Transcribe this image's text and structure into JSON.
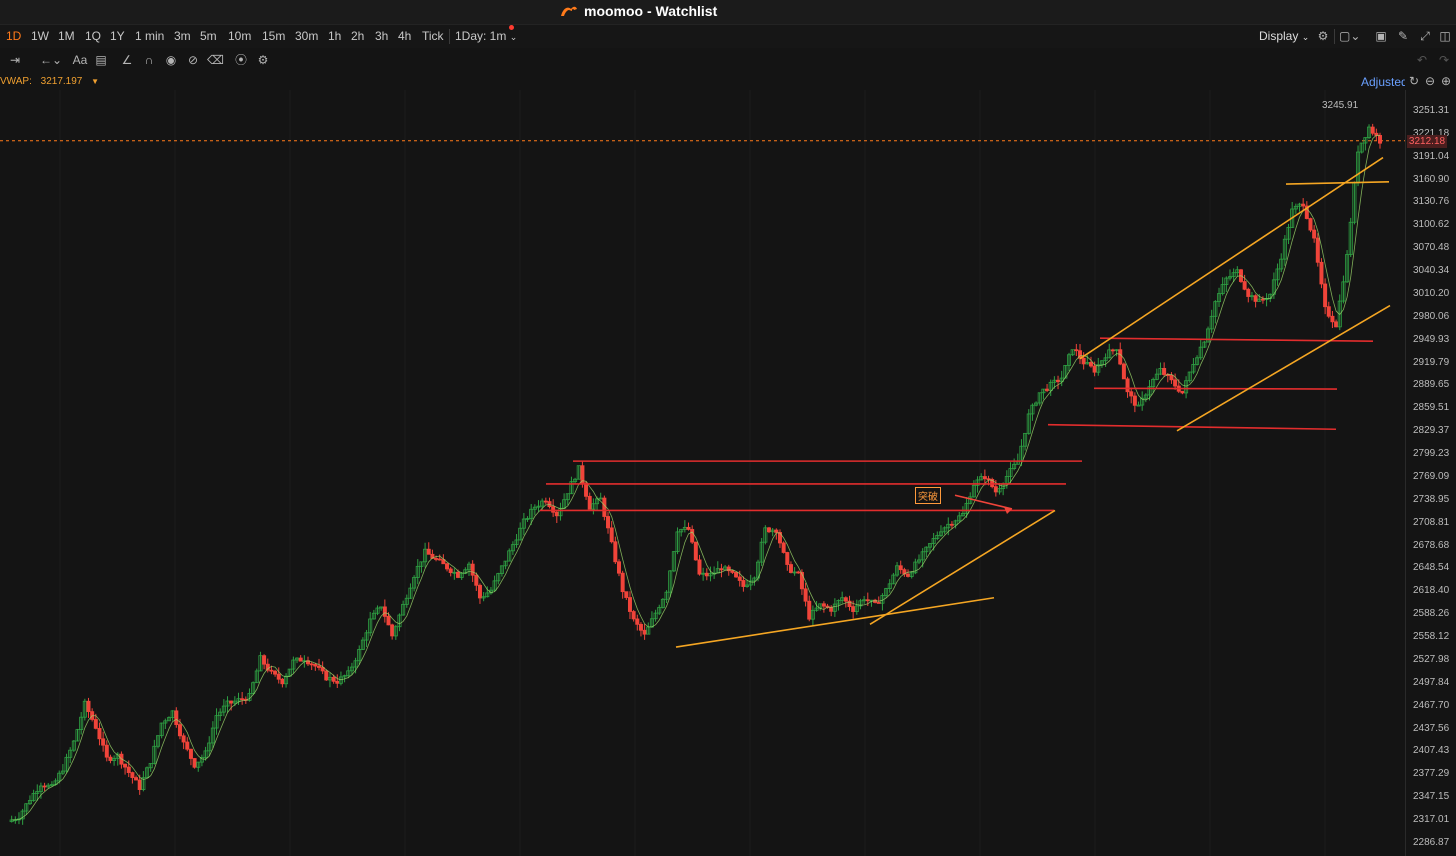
{
  "window": {
    "title": "moomoo - Watchlist"
  },
  "colors": {
    "accent": "#ff7a1a",
    "up": "#2ea043",
    "down": "#f0443a",
    "channel": "#f5a623",
    "level": "#e22d2d",
    "ma": "#9bd66a",
    "link": "#6aa0ff"
  },
  "toolbar": {
    "timeframes": [
      {
        "label": "1D",
        "active": true
      },
      {
        "label": "1W",
        "active": false
      },
      {
        "label": "1M",
        "active": false
      },
      {
        "label": "1Q",
        "active": false
      },
      {
        "label": "1Y",
        "active": false
      },
      {
        "label": "1 min",
        "active": false
      },
      {
        "label": "3m",
        "active": false
      },
      {
        "label": "5m",
        "active": false
      },
      {
        "label": "10m",
        "active": false
      },
      {
        "label": "15m",
        "active": false
      },
      {
        "label": "30m",
        "active": false
      },
      {
        "label": "1h",
        "active": false
      },
      {
        "label": "2h",
        "active": false
      },
      {
        "label": "3h",
        "active": false
      },
      {
        "label": "4h",
        "active": false
      },
      {
        "label": "Tick",
        "active": false
      }
    ],
    "interval_selector": "1Day: 1m",
    "display_label": "Display",
    "icons": [
      "settings-icon",
      "layout-icon",
      "camera-icon",
      "pencil-icon",
      "fullscreen-icon",
      "sidebar-icon"
    ]
  },
  "drawing_tools": [
    "measure-icon",
    "arrow-left-icon",
    "text-tool-icon",
    "comment-icon",
    "trendline-icon",
    "magnet-icon",
    "eye-icon",
    "hide-icon",
    "trash-icon",
    "link-icon",
    "settings-icon"
  ],
  "indicator": {
    "label": "VWAP:",
    "value": "3217.197"
  },
  "adjusted_label": "Adjusted",
  "price_axis": [
    "3251.31",
    "3221.18",
    "3191.04",
    "3160.90",
    "3130.76",
    "3100.62",
    "3070.48",
    "3040.34",
    "3010.20",
    "2980.06",
    "2949.93",
    "2919.79",
    "2889.65",
    "2859.51",
    "2829.37",
    "2799.23",
    "2769.09",
    "2738.95",
    "2708.81",
    "2678.68",
    "2648.54",
    "2618.40",
    "2588.26",
    "2558.12",
    "2527.98",
    "2497.84",
    "2467.70",
    "2437.56",
    "2407.43",
    "2377.29",
    "2347.15",
    "2317.01",
    "2286.87"
  ],
  "current_price": "3212.18",
  "max_price_label": "3245.91",
  "annotation": "突破",
  "chart_data": {
    "type": "candlestick",
    "y_range": [
      2286.87,
      3251.31
    ],
    "last_price": 3212.18,
    "max_label": 3245.91,
    "path": [
      2315,
      2322,
      2345,
      2365,
      2360,
      2385,
      2420,
      2470,
      2440,
      2398,
      2402,
      2380,
      2360,
      2395,
      2445,
      2460,
      2418,
      2390,
      2405,
      2455,
      2470,
      2475,
      2480,
      2530,
      2510,
      2500,
      2526,
      2530,
      2520,
      2505,
      2500,
      2510,
      2540,
      2580,
      2600,
      2560,
      2600,
      2640,
      2670,
      2660,
      2650,
      2640,
      2655,
      2610,
      2620,
      2650,
      2680,
      2710,
      2730,
      2740,
      2720,
      2750,
      2780,
      2730,
      2740,
      2680,
      2620,
      2580,
      2560,
      2590,
      2620,
      2700,
      2700,
      2640,
      2640,
      2650,
      2640,
      2625,
      2640,
      2700,
      2700,
      2650,
      2640,
      2585,
      2600,
      2595,
      2610,
      2595,
      2610,
      2600,
      2620,
      2650,
      2640,
      2660,
      2680,
      2700,
      2710,
      2720,
      2760,
      2770,
      2750,
      2770,
      2790,
      2850,
      2880,
      2890,
      2900,
      2940,
      2920,
      2910,
      2930,
      2940,
      2880,
      2860,
      2890,
      2910,
      2895,
      2880,
      2920,
      2950,
      3000,
      3030,
      3040,
      3010,
      3000,
      3010,
      3060,
      3120,
      3130,
      3080,
      2990,
      2970,
      3060,
      3200,
      3230,
      3212
    ],
    "levels": [
      {
        "y": 2790,
        "from": 2790,
        "to": 2790
      },
      {
        "y": 2760,
        "from": 2760,
        "to": 2760
      },
      {
        "y": 2725,
        "from": 2725,
        "to": 2725
      },
      {
        "y": 2950,
        "from": 2952,
        "to": 2948
      },
      {
        "y": 2885,
        "from": 2886,
        "to": 2885
      },
      {
        "y": 2837,
        "from": 2838,
        "to": 2832
      }
    ],
    "trendlines": [
      {
        "from": 2545,
        "to": 2610
      },
      {
        "from": 2575,
        "to": 2725
      },
      {
        "from": 2925,
        "to": 3190
      },
      {
        "from": 2830,
        "to": 2995
      },
      {
        "from": 3155,
        "to": 3158
      }
    ]
  }
}
